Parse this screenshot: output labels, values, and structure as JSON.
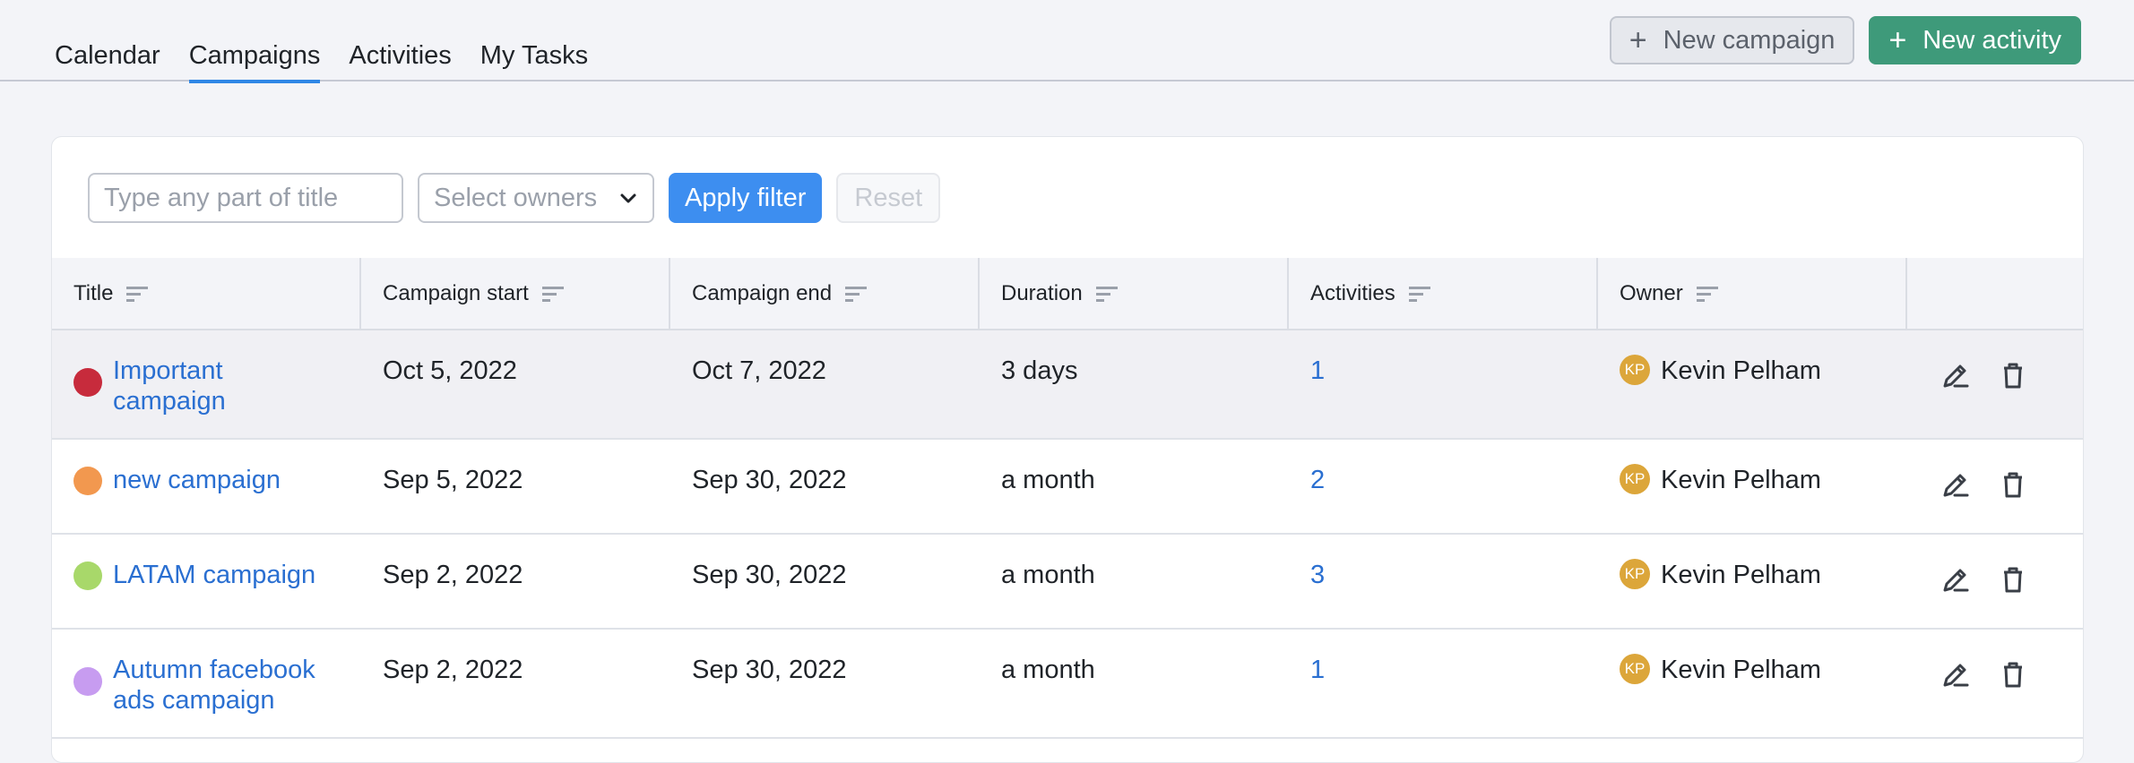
{
  "tabs": [
    {
      "label": "Calendar",
      "active": false
    },
    {
      "label": "Campaigns",
      "active": true
    },
    {
      "label": "Activities",
      "active": false
    },
    {
      "label": "My Tasks",
      "active": false
    }
  ],
  "actions": {
    "new_campaign_label": "New campaign",
    "new_activity_label": "New activity",
    "plus_icon": "+"
  },
  "filters": {
    "title_placeholder": "Type any part of title",
    "owners_placeholder": "Select owners",
    "apply_label": "Apply filter",
    "reset_label": "Reset"
  },
  "table": {
    "columns": [
      "Title",
      "Campaign start",
      "Campaign end",
      "Duration",
      "Activities",
      "Owner"
    ],
    "rows": [
      {
        "title": "Important campaign",
        "color": "#c72b3c",
        "start": "Oct 5, 2022",
        "end": "Oct 7, 2022",
        "duration": "3 days",
        "activities": "1",
        "owner_initials": "KP",
        "owner": "Kevin Pelham"
      },
      {
        "title": "new campaign",
        "color": "#f2984f",
        "start": "Sep 5, 2022",
        "end": "Sep 30, 2022",
        "duration": "a month",
        "activities": "2",
        "owner_initials": "KP",
        "owner": "Kevin Pelham"
      },
      {
        "title": "LATAM campaign",
        "color": "#a8d86a",
        "start": "Sep 2, 2022",
        "end": "Sep 30, 2022",
        "duration": "a month",
        "activities": "3",
        "owner_initials": "KP",
        "owner": "Kevin Pelham"
      },
      {
        "title": "Autumn facebook ads campaign",
        "color": "#c79cf0",
        "start": "Sep 2, 2022",
        "end": "Sep 30, 2022",
        "duration": "a month",
        "activities": "1",
        "owner_initials": "KP",
        "owner": "Kevin Pelham"
      }
    ]
  },
  "colors": {
    "accent_tab": "#2f87e6",
    "primary_button": "#3e9a7a",
    "apply_button": "#3d8ef0",
    "link": "#2a6fd1",
    "avatar": "#dca63a"
  }
}
